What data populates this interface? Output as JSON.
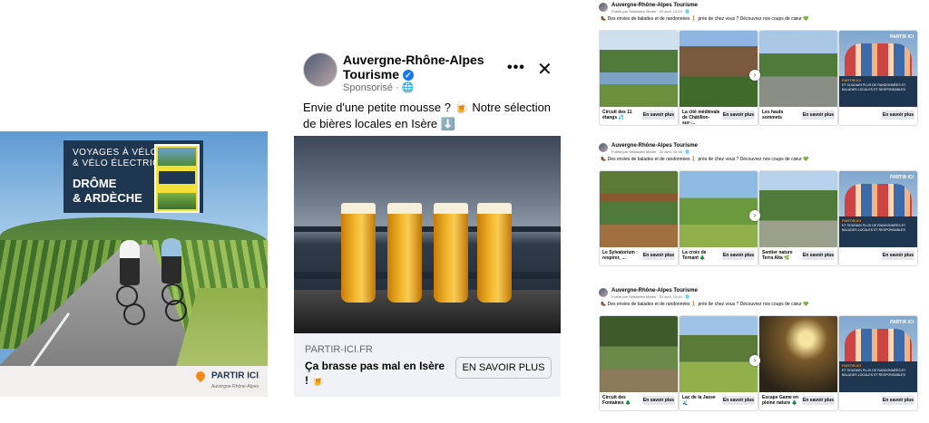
{
  "poster": {
    "line1": "VOYAGES À VÉLO",
    "line2": "& VÉLO ÉLECTRIQUE",
    "line3": "DRÔME",
    "line4": "& ARDÈCHE",
    "logo": "PARTIR ICI",
    "logo_sub": "Auvergne-Rhône-Alpes"
  },
  "ad": {
    "page_name": "Auvergne-Rhône-Alpes Tourisme",
    "verified": "✓",
    "sponsored": "Sponsorisé · 🌐",
    "more": "•••",
    "close": "✕",
    "body": "Envie d'une petite mousse ? 🍺 Notre sélection de bières locales en Isère ⬇️",
    "domain": "PARTIR-ICI.FR",
    "headline": "Ça brasse pas mal en Isère ! 🍺",
    "cta": "EN SAVOIR PLUS"
  },
  "posts": [
    {
      "name": "Auvergne-Rhône-Alpes Tourisme",
      "meta": "Publié par Sébastien Martin · 22 avril, 15:53 · 🌐",
      "text": "🥾 Des envies de balades et de randonnées 🚶 près de chez vous ? Découvrez nos coups de cœur 💚",
      "cards": [
        {
          "title": "Circuit des 11 étangs 💦",
          "btn": "En savoir plus"
        },
        {
          "title": "La cité médiévale de Châtillon-sur-…",
          "btn": "En savoir plus"
        },
        {
          "title": "Les hauts sommets",
          "btn": "En savoir plus"
        },
        {
          "title": "",
          "btn": "En savoir plus"
        }
      ]
    },
    {
      "name": "Auvergne-Rhône-Alpes Tourisme",
      "meta": "Publié par Sébastien Martin · 22 avril, 15:38 · 🌐",
      "text": "🥾 Des envies de balades et de randonnées 🚶 près de chez vous ? Découvrez nos coups de cœur 💚",
      "cards": [
        {
          "title": "Le Sylvatorium : respirer, …",
          "btn": "En savoir plus"
        },
        {
          "title": "La croix de Ternant 🌲",
          "btn": "En savoir plus"
        },
        {
          "title": "Sentier nature Terra Alta 🌿",
          "btn": "En savoir plus"
        },
        {
          "title": "",
          "btn": "En savoir plus"
        }
      ]
    },
    {
      "name": "Auvergne-Rhône-Alpes Tourisme",
      "meta": "Publié par Sébastien Martin · 22 avril, 15:44 · 🌐",
      "text": "🥾 Des envies de balades et de randonnées 🚶 près de chez vous ? Découvrez nos coups de cœur 💚",
      "cards": [
        {
          "title": "Circuit des Fontaines 🌲",
          "btn": "En savoir plus"
        },
        {
          "title": "Lac de la Jasse 🌊",
          "btn": "En savoir plus"
        },
        {
          "title": "Escape Game en pleine nature 🌲",
          "btn": "En savoir plus"
        },
        {
          "title": "",
          "btn": "En savoir plus"
        }
      ]
    }
  ],
  "promo": {
    "logo": "PARTIR ICI",
    "tag": "PARTIR-ICI",
    "text": "ET SOUDAIN PLUS DE RANDONNÉES ET BALADES LOCALES ET RESPONSABLES"
  }
}
